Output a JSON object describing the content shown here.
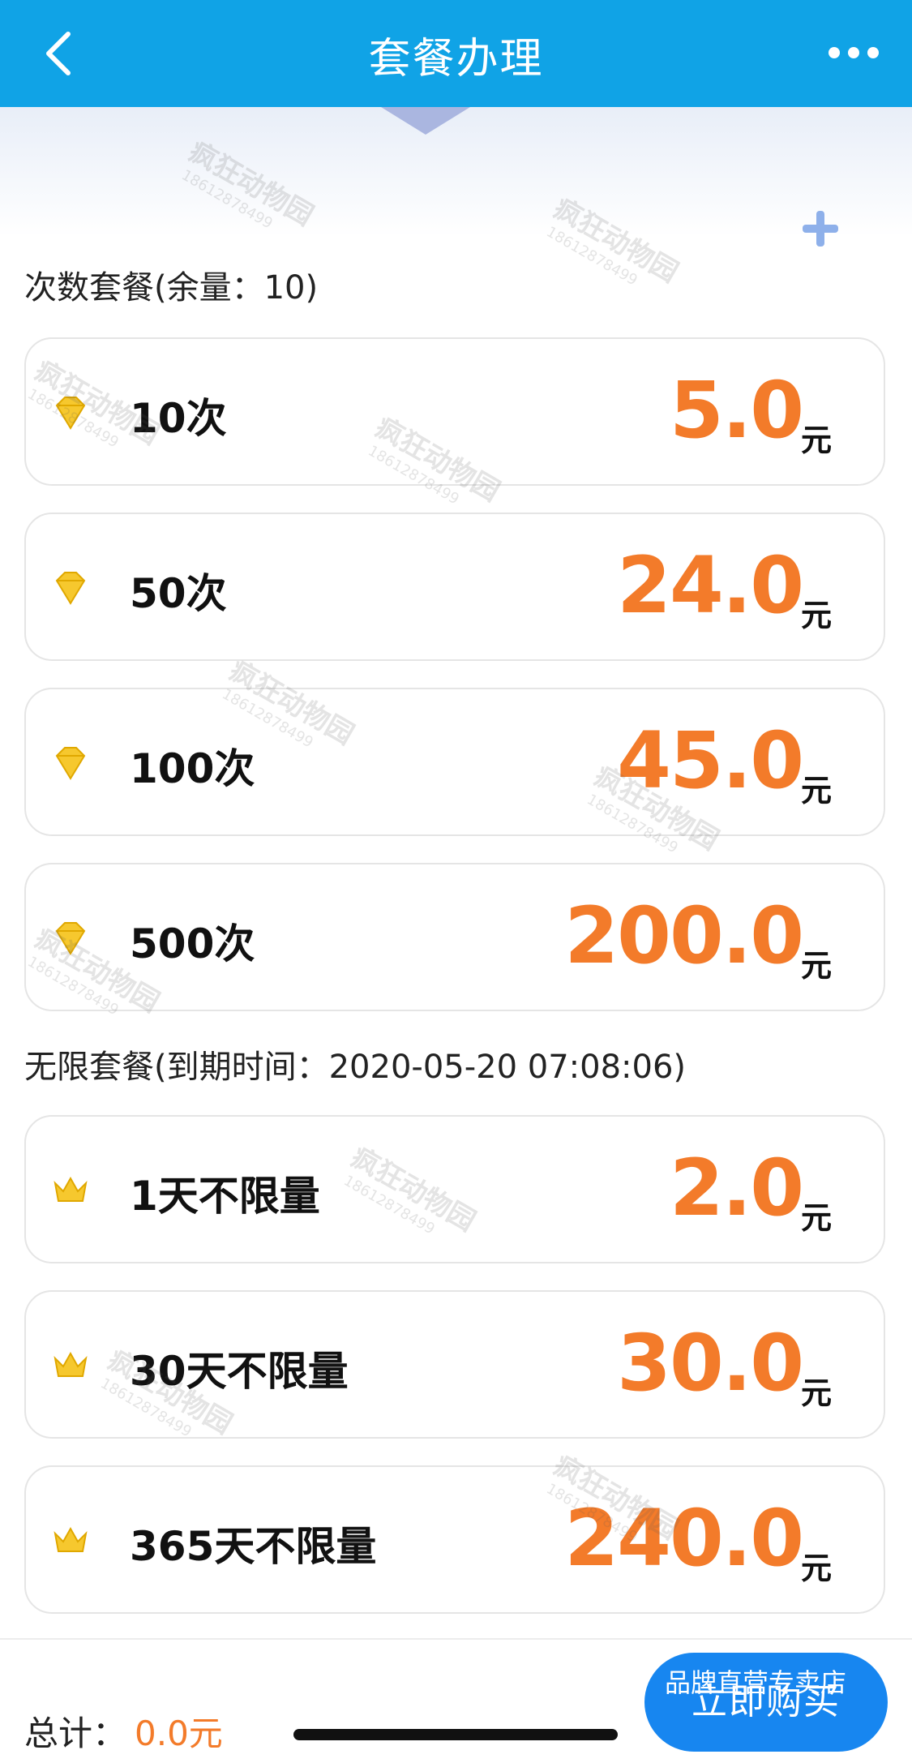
{
  "header": {
    "title": "套餐办理",
    "back_icon": "chevron-left-icon",
    "more_icon": "more-dots-icon",
    "bg_color": "#10a3e6"
  },
  "count_section": {
    "title": "次数套餐(余量：10)"
  },
  "count_packages": [
    {
      "name": "10次",
      "price": "5.0",
      "unit": "元",
      "icon": "diamond-icon"
    },
    {
      "name": "50次",
      "price": "24.0",
      "unit": "元",
      "icon": "diamond-icon"
    },
    {
      "name": "100次",
      "price": "45.0",
      "unit": "元",
      "icon": "diamond-icon"
    },
    {
      "name": "500次",
      "price": "200.0",
      "unit": "元",
      "icon": "diamond-icon"
    }
  ],
  "unlimited_section": {
    "title": "无限套餐(到期时间：2020-05-20 07:08:06)"
  },
  "unlimited_packages": [
    {
      "name": "1天不限量",
      "price": "2.0",
      "unit": "元",
      "icon": "crown-icon"
    },
    {
      "name": "30天不限量",
      "price": "30.0",
      "unit": "元",
      "icon": "crown-icon"
    },
    {
      "name": "365天不限量",
      "price": "240.0",
      "unit": "元",
      "icon": "crown-icon"
    }
  ],
  "footer": {
    "total_label": "总计：",
    "total_value": "0.0元",
    "buy_label": "立即购买",
    "store_badge": "品牌直营专卖店"
  },
  "watermark": {
    "text": "疯狂动物园",
    "phone": "18612878499"
  },
  "colors": {
    "price": "#f37b2a",
    "button": "#1786f0"
  }
}
